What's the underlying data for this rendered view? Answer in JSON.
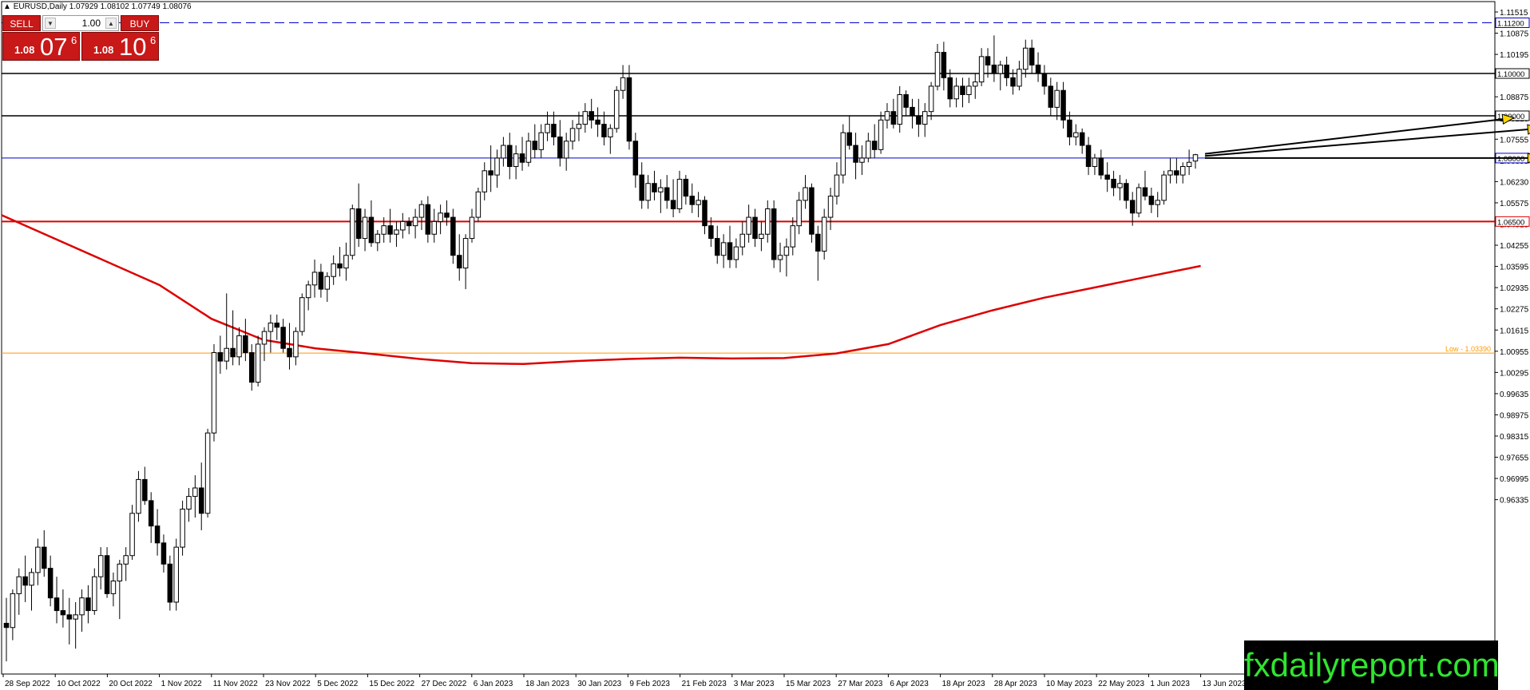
{
  "header": {
    "text": "EURUSD,Daily  1.07929 1.08102 1.07749 1.08076"
  },
  "trade_panel": {
    "sell_label": "SELL",
    "buy_label": "BUY",
    "lot": "1.00",
    "sell_price_small": "1.08",
    "sell_price_big": "07",
    "sell_price_sup": "6",
    "buy_price_small": "1.08",
    "buy_price_big": "10",
    "buy_price_sup": "6",
    "down_icon": "triangle-down-icon",
    "up_icon": "triangle-up-icon"
  },
  "logo": "fxdailyreport.com",
  "chart_data": {
    "type": "candlestick",
    "symbol": "EURUSD",
    "timeframe": "Daily",
    "ylim": [
      0.958,
      1.117
    ],
    "y_ticks": [
      "1.11515",
      "1.10875",
      "1.10195",
      "1.09555",
      "1.08875",
      "1.08215",
      "1.07555",
      "1.06895",
      "1.06230",
      "1.05575",
      "1.04915",
      "1.04255",
      "1.03595",
      "1.02935",
      "1.02275",
      "1.01615",
      "1.00955",
      "1.00295",
      "0.99635",
      "0.98975",
      "0.98315",
      "0.97655",
      "0.96995",
      "0.96335"
    ],
    "x_labels": [
      "28 Sep 2022",
      "10 Oct 2022",
      "20 Oct 2022",
      "1 Nov 2022",
      "11 Nov 2022",
      "23 Nov 2022",
      "5 Dec 2022",
      "15 Dec 2022",
      "27 Dec 2022",
      "6 Jan 2023",
      "18 Jan 2023",
      "30 Jan 2023",
      "9 Feb 2023",
      "21 Feb 2023",
      "3 Mar 2023",
      "15 Mar 2023",
      "27 Mar 2023",
      "6 Apr 2023",
      "18 Apr 2023",
      "28 Apr 2023",
      "10 May 2023",
      "22 May 2023",
      "1 Jun 2023",
      "13 Jun 2023"
    ],
    "horizontal_lines": [
      {
        "price": 1.112,
        "label": "1.11200",
        "color": "#0000cc",
        "style": "dashed"
      },
      {
        "price": 1.1,
        "label": "1.10000",
        "color": "#000000",
        "style": "solid"
      },
      {
        "price": 1.09,
        "label": "1.09000",
        "color": "#000000",
        "style": "solid"
      },
      {
        "price": 1.08,
        "label": "1.08000",
        "color": "#0000cc",
        "style": "solid"
      },
      {
        "price": 1.065,
        "label": "1.06500",
        "color": "#dd0000",
        "style": "solid"
      },
      {
        "price": 1.0339,
        "label": "Low - 1.03390",
        "color": "#ff9900",
        "style": "solid"
      }
    ],
    "moving_average": {
      "color": "#dd0000",
      "points": [
        [
          "28 Sep 2022",
          1.0665
        ],
        [
          "1 Nov 2022",
          1.05
        ],
        [
          "11 Nov 2022",
          1.042
        ],
        [
          "23 Nov 2022",
          1.037
        ],
        [
          "5 Dec 2022",
          1.035
        ],
        [
          "15 Dec 2022",
          1.0338
        ],
        [
          "27 Dec 2022",
          1.0325
        ],
        [
          "6 Jan 2023",
          1.0315
        ],
        [
          "18 Jan 2023",
          1.0313
        ],
        [
          "30 Jan 2023",
          1.032
        ],
        [
          "9 Feb 2023",
          1.0325
        ],
        [
          "21 Feb 2023",
          1.0328
        ],
        [
          "3 Mar 2023",
          1.0326
        ],
        [
          "15 Mar 2023",
          1.0327
        ],
        [
          "27 Mar 2023",
          1.0338
        ],
        [
          "6 Apr 2023",
          1.036
        ],
        [
          "18 Apr 2023",
          1.0405
        ],
        [
          "28 Apr 2023",
          1.044
        ],
        [
          "10 May 2023",
          1.047
        ],
        [
          "22 May 2023",
          1.0495
        ],
        [
          "1 Jun 2023",
          1.052
        ],
        [
          "13 Jun 2023",
          1.0545
        ]
      ]
    },
    "candles": [
      [
        0.97,
        0.976,
        0.961,
        0.969
      ],
      [
        0.969,
        0.978,
        0.966,
        0.977
      ],
      [
        0.977,
        0.983,
        0.972,
        0.981
      ],
      [
        0.981,
        0.986,
        0.975,
        0.979
      ],
      [
        0.979,
        0.983,
        0.973,
        0.982
      ],
      [
        0.982,
        0.99,
        0.979,
        0.988
      ],
      [
        0.988,
        0.992,
        0.981,
        0.983
      ],
      [
        0.983,
        0.986,
        0.974,
        0.976
      ],
      [
        0.976,
        0.981,
        0.97,
        0.973
      ],
      [
        0.973,
        0.978,
        0.969,
        0.972
      ],
      [
        0.972,
        0.976,
        0.965,
        0.971
      ],
      [
        0.971,
        0.975,
        0.964,
        0.972
      ],
      [
        0.972,
        0.978,
        0.968,
        0.976
      ],
      [
        0.976,
        0.979,
        0.97,
        0.973
      ],
      [
        0.973,
        0.983,
        0.972,
        0.981
      ],
      [
        0.981,
        0.988,
        0.978,
        0.986
      ],
      [
        0.986,
        0.988,
        0.976,
        0.977
      ],
      [
        0.977,
        0.982,
        0.974,
        0.98
      ],
      [
        0.98,
        0.985,
        0.971,
        0.984
      ],
      [
        0.984,
        0.988,
        0.98,
        0.986
      ],
      [
        0.986,
        0.998,
        0.985,
        0.996
      ],
      [
        0.996,
        1.006,
        0.994,
        1.004
      ],
      [
        1.004,
        1.007,
        0.998,
        0.999
      ],
      [
        0.999,
        1.001,
        0.989,
        0.993
      ],
      [
        0.993,
        0.997,
        0.986,
        0.989
      ],
      [
        0.989,
        0.991,
        0.982,
        0.984
      ],
      [
        0.984,
        0.986,
        0.973,
        0.975
      ],
      [
        0.975,
        0.99,
        0.973,
        0.988
      ],
      [
        0.988,
        0.999,
        0.986,
        0.997
      ],
      [
        0.997,
        1.002,
        0.994,
        1.0
      ],
      [
        1.0,
        1.005,
        0.995,
        1.002
      ],
      [
        1.002,
        1.008,
        0.992,
        0.996
      ],
      [
        0.996,
        1.016,
        0.995,
        1.015
      ],
      [
        1.015,
        1.036,
        1.013,
        1.034
      ],
      [
        1.034,
        1.038,
        1.029,
        1.032
      ],
      [
        1.032,
        1.048,
        1.03,
        1.035
      ],
      [
        1.035,
        1.044,
        1.031,
        1.033
      ],
      [
        1.033,
        1.04,
        1.031,
        1.038
      ],
      [
        1.038,
        1.042,
        1.032,
        1.034
      ],
      [
        1.034,
        1.036,
        1.025,
        1.027
      ],
      [
        1.027,
        1.038,
        1.026,
        1.036
      ],
      [
        1.036,
        1.04,
        1.032,
        1.039
      ],
      [
        1.039,
        1.043,
        1.034,
        1.041
      ],
      [
        1.041,
        1.043,
        1.037,
        1.04
      ],
      [
        1.04,
        1.042,
        1.034,
        1.035
      ],
      [
        1.035,
        1.041,
        1.03,
        1.033
      ],
      [
        1.033,
        1.04,
        1.031,
        1.039
      ],
      [
        1.039,
        1.048,
        1.038,
        1.047
      ],
      [
        1.047,
        1.051,
        1.044,
        1.05
      ],
      [
        1.05,
        1.056,
        1.047,
        1.053
      ],
      [
        1.053,
        1.055,
        1.047,
        1.049
      ],
      [
        1.049,
        1.053,
        1.046,
        1.052
      ],
      [
        1.052,
        1.057,
        1.05,
        1.055
      ],
      [
        1.055,
        1.059,
        1.052,
        1.054
      ],
      [
        1.054,
        1.06,
        1.051,
        1.057
      ],
      [
        1.057,
        1.069,
        1.056,
        1.068
      ],
      [
        1.068,
        1.074,
        1.059,
        1.061
      ],
      [
        1.061,
        1.068,
        1.058,
        1.066
      ],
      [
        1.066,
        1.07,
        1.059,
        1.06
      ],
      [
        1.06,
        1.063,
        1.058,
        1.062
      ],
      [
        1.062,
        1.066,
        1.06,
        1.064
      ],
      [
        1.064,
        1.068,
        1.06,
        1.062
      ],
      [
        1.062,
        1.065,
        1.059,
        1.063
      ],
      [
        1.063,
        1.067,
        1.061,
        1.065
      ],
      [
        1.065,
        1.066,
        1.062,
        1.064
      ],
      [
        1.064,
        1.068,
        1.061,
        1.066
      ],
      [
        1.066,
        1.07,
        1.063,
        1.069
      ],
      [
        1.069,
        1.071,
        1.06,
        1.062
      ],
      [
        1.062,
        1.068,
        1.06,
        1.065
      ],
      [
        1.065,
        1.069,
        1.062,
        1.067
      ],
      [
        1.067,
        1.07,
        1.064,
        1.066
      ],
      [
        1.066,
        1.068,
        1.055,
        1.057
      ],
      [
        1.057,
        1.062,
        1.051,
        1.054
      ],
      [
        1.054,
        1.062,
        1.049,
        1.061
      ],
      [
        1.061,
        1.068,
        1.06,
        1.066
      ],
      [
        1.066,
        1.073,
        1.065,
        1.072
      ],
      [
        1.072,
        1.079,
        1.07,
        1.077
      ],
      [
        1.077,
        1.083,
        1.072,
        1.076
      ],
      [
        1.076,
        1.082,
        1.073,
        1.08
      ],
      [
        1.08,
        1.085,
        1.078,
        1.083
      ],
      [
        1.083,
        1.086,
        1.075,
        1.078
      ],
      [
        1.078,
        1.083,
        1.075,
        1.081
      ],
      [
        1.081,
        1.085,
        1.077,
        1.079
      ],
      [
        1.079,
        1.086,
        1.078,
        1.084
      ],
      [
        1.084,
        1.088,
        1.08,
        1.082
      ],
      [
        1.082,
        1.088,
        1.08,
        1.086
      ],
      [
        1.086,
        1.091,
        1.084,
        1.088
      ],
      [
        1.088,
        1.091,
        1.083,
        1.085
      ],
      [
        1.085,
        1.089,
        1.078,
        1.08
      ],
      [
        1.08,
        1.086,
        1.077,
        1.084
      ],
      [
        1.084,
        1.089,
        1.082,
        1.087
      ],
      [
        1.087,
        1.091,
        1.084,
        1.088
      ],
      [
        1.088,
        1.093,
        1.086,
        1.091
      ],
      [
        1.091,
        1.094,
        1.087,
        1.089
      ],
      [
        1.089,
        1.092,
        1.085,
        1.088
      ],
      [
        1.088,
        1.091,
        1.083,
        1.085
      ],
      [
        1.085,
        1.088,
        1.081,
        1.087
      ],
      [
        1.087,
        1.097,
        1.086,
        1.096
      ],
      [
        1.096,
        1.102,
        1.094,
        1.099
      ],
      [
        1.099,
        1.102,
        1.082,
        1.084
      ],
      [
        1.084,
        1.086,
        1.073,
        1.076
      ],
      [
        1.076,
        1.079,
        1.068,
        1.07
      ],
      [
        1.07,
        1.076,
        1.068,
        1.074
      ],
      [
        1.074,
        1.077,
        1.07,
        1.072
      ],
      [
        1.072,
        1.075,
        1.067,
        1.073
      ],
      [
        1.073,
        1.076,
        1.068,
        1.07
      ],
      [
        1.07,
        1.075,
        1.066,
        1.068
      ],
      [
        1.068,
        1.077,
        1.067,
        1.075
      ],
      [
        1.075,
        1.076,
        1.069,
        1.071
      ],
      [
        1.071,
        1.074,
        1.067,
        1.069
      ],
      [
        1.069,
        1.072,
        1.066,
        1.07
      ],
      [
        1.07,
        1.071,
        1.062,
        1.064
      ],
      [
        1.064,
        1.066,
        1.059,
        1.061
      ],
      [
        1.061,
        1.064,
        1.055,
        1.057
      ],
      [
        1.057,
        1.062,
        1.054,
        1.06
      ],
      [
        1.06,
        1.064,
        1.054,
        1.056
      ],
      [
        1.056,
        1.061,
        1.054,
        1.059
      ],
      [
        1.059,
        1.065,
        1.057,
        1.062
      ],
      [
        1.062,
        1.069,
        1.06,
        1.066
      ],
      [
        1.066,
        1.068,
        1.059,
        1.061
      ],
      [
        1.061,
        1.065,
        1.058,
        1.062
      ],
      [
        1.062,
        1.07,
        1.06,
        1.068
      ],
      [
        1.068,
        1.07,
        1.054,
        1.056
      ],
      [
        1.056,
        1.06,
        1.053,
        1.057
      ],
      [
        1.057,
        1.061,
        1.052,
        1.059
      ],
      [
        1.059,
        1.066,
        1.057,
        1.064
      ],
      [
        1.064,
        1.072,
        1.062,
        1.07
      ],
      [
        1.07,
        1.076,
        1.068,
        1.073
      ],
      [
        1.073,
        1.074,
        1.06,
        1.062
      ],
      [
        1.062,
        1.064,
        1.051,
        1.058
      ],
      [
        1.058,
        1.068,
        1.056,
        1.066
      ],
      [
        1.066,
        1.073,
        1.063,
        1.071
      ],
      [
        1.071,
        1.079,
        1.069,
        1.076
      ],
      [
        1.076,
        1.088,
        1.074,
        1.086
      ],
      [
        1.086,
        1.09,
        1.082,
        1.083
      ],
      [
        1.083,
        1.086,
        1.075,
        1.079
      ],
      [
        1.079,
        1.083,
        1.076,
        1.08
      ],
      [
        1.08,
        1.086,
        1.079,
        1.084
      ],
      [
        1.084,
        1.088,
        1.08,
        1.082
      ],
      [
        1.082,
        1.091,
        1.081,
        1.089
      ],
      [
        1.089,
        1.093,
        1.087,
        1.091
      ],
      [
        1.091,
        1.094,
        1.087,
        1.088
      ],
      [
        1.088,
        1.097,
        1.086,
        1.095
      ],
      [
        1.095,
        1.096,
        1.09,
        1.092
      ],
      [
        1.092,
        1.094,
        1.087,
        1.09
      ],
      [
        1.09,
        1.094,
        1.085,
        1.088
      ],
      [
        1.088,
        1.093,
        1.085,
        1.091
      ],
      [
        1.091,
        1.098,
        1.089,
        1.097
      ],
      [
        1.097,
        1.107,
        1.096,
        1.105
      ],
      [
        1.105,
        1.1075,
        1.096,
        1.099
      ],
      [
        1.099,
        1.101,
        1.092,
        1.094
      ],
      [
        1.094,
        1.099,
        1.092,
        1.097
      ],
      [
        1.097,
        1.099,
        1.092,
        1.095
      ],
      [
        1.095,
        1.099,
        1.093,
        1.097
      ],
      [
        1.097,
        1.1,
        1.094,
        1.098
      ],
      [
        1.098,
        1.106,
        1.097,
        1.104
      ],
      [
        1.104,
        1.106,
        1.099,
        1.102
      ],
      [
        1.102,
        1.109,
        1.098,
        1.1
      ],
      [
        1.1,
        1.103,
        1.096,
        1.102
      ],
      [
        1.102,
        1.104,
        1.097,
        1.099
      ],
      [
        1.099,
        1.101,
        1.095,
        1.097
      ],
      [
        1.097,
        1.103,
        1.096,
        1.101
      ],
      [
        1.101,
        1.108,
        1.099,
        1.106
      ],
      [
        1.106,
        1.108,
        1.1,
        1.102
      ],
      [
        1.102,
        1.105,
        1.098,
        1.1
      ],
      [
        1.1,
        1.102,
        1.095,
        1.097
      ],
      [
        1.097,
        1.099,
        1.09,
        1.092
      ],
      [
        1.092,
        1.098,
        1.089,
        1.096
      ],
      [
        1.096,
        1.098,
        1.087,
        1.089
      ],
      [
        1.089,
        1.091,
        1.083,
        1.085
      ],
      [
        1.085,
        1.088,
        1.083,
        1.086
      ],
      [
        1.086,
        1.087,
        1.081,
        1.083
      ],
      [
        1.083,
        1.085,
        1.076,
        1.078
      ],
      [
        1.078,
        1.081,
        1.076,
        1.08
      ],
      [
        1.08,
        1.082,
        1.075,
        1.076
      ],
      [
        1.076,
        1.079,
        1.072,
        1.075
      ],
      [
        1.075,
        1.077,
        1.071,
        1.073
      ],
      [
        1.073,
        1.076,
        1.07,
        1.074
      ],
      [
        1.074,
        1.075,
        1.068,
        1.07
      ],
      [
        1.07,
        1.072,
        1.064,
        1.067
      ],
      [
        1.067,
        1.074,
        1.066,
        1.073
      ],
      [
        1.073,
        1.077,
        1.07,
        1.071
      ],
      [
        1.071,
        1.073,
        1.067,
        1.069
      ],
      [
        1.069,
        1.072,
        1.066,
        1.07
      ],
      [
        1.07,
        1.077,
        1.069,
        1.076
      ],
      [
        1.076,
        1.08,
        1.074,
        1.077
      ],
      [
        1.077,
        1.08,
        1.074,
        1.076
      ],
      [
        1.076,
        1.079,
        1.074,
        1.078
      ],
      [
        1.078,
        1.082,
        1.076,
        1.079
      ],
      [
        1.0793,
        1.081,
        1.0775,
        1.0808
      ]
    ],
    "annotations": [
      {
        "type": "arrow",
        "from": [
          "13 Jun 2023",
          1.081
        ],
        "to_index": 232,
        "to_price": 1.088,
        "color": "#ffd700"
      },
      {
        "type": "arrow",
        "from": [
          "13 Jun 2023",
          1.0805
        ],
        "to_index": 236,
        "to_price": 1.087,
        "color": "#ffd700"
      },
      {
        "type": "arrow",
        "from": [
          "13 Jun 2023",
          1.08
        ],
        "to_index": 236,
        "to_price": 1.08,
        "color": "#ffd700"
      }
    ]
  }
}
